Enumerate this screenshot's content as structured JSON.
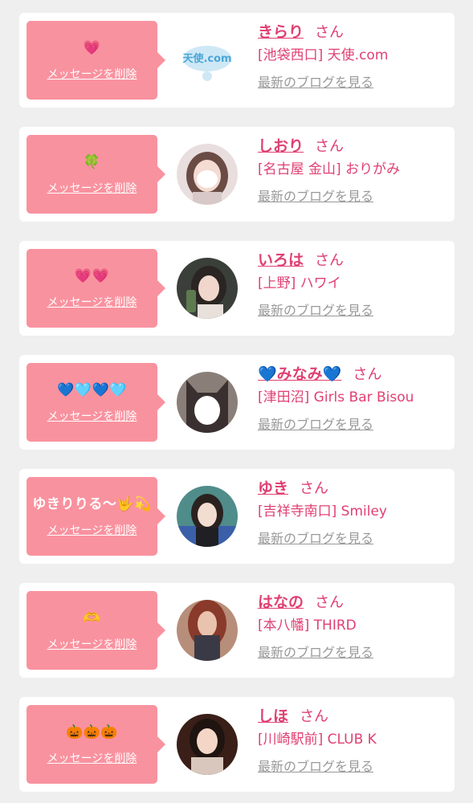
{
  "items": [
    {
      "message": "💗",
      "delete_label": "メッセージを削除",
      "name": "きらり",
      "honorific": "さん",
      "shop": "[池袋西口] 天使.com",
      "blog_label": "最新のブログを見る",
      "avatar_logo_text": "天使.com"
    },
    {
      "message": "🍀",
      "delete_label": "メッセージを削除",
      "name": "しおり",
      "honorific": "さん",
      "shop": "[名古屋 金山] おりがみ",
      "blog_label": "最新のブログを見る"
    },
    {
      "message": "💗💗",
      "delete_label": "メッセージを削除",
      "name": "いろは",
      "honorific": "さん",
      "shop": "[上野] ハワイ",
      "blog_label": "最新のブログを見る"
    },
    {
      "message": "💙🩵💙🩵",
      "delete_label": "メッセージを削除",
      "name": "💙みなみ💙",
      "honorific": "さん",
      "shop": "[津田沼] Girls Bar Bisou",
      "blog_label": "最新のブログを見る"
    },
    {
      "message": "ゆきりりる〜🤟💫",
      "delete_label": "メッセージを削除",
      "name": "ゆき",
      "honorific": "さん",
      "shop": "[吉祥寺南口] Smiley",
      "blog_label": "最新のブログを見る"
    },
    {
      "message": "🫶",
      "delete_label": "メッセージを削除",
      "name": "はなの",
      "honorific": "さん",
      "shop": "[本八幡] THIRD",
      "blog_label": "最新のブログを見る"
    },
    {
      "message": "🎃🎃🎃",
      "delete_label": "メッセージを削除",
      "name": "しほ",
      "honorific": "さん",
      "shop": "[川崎駅前] CLUB K",
      "blog_label": "最新のブログを見る"
    }
  ]
}
